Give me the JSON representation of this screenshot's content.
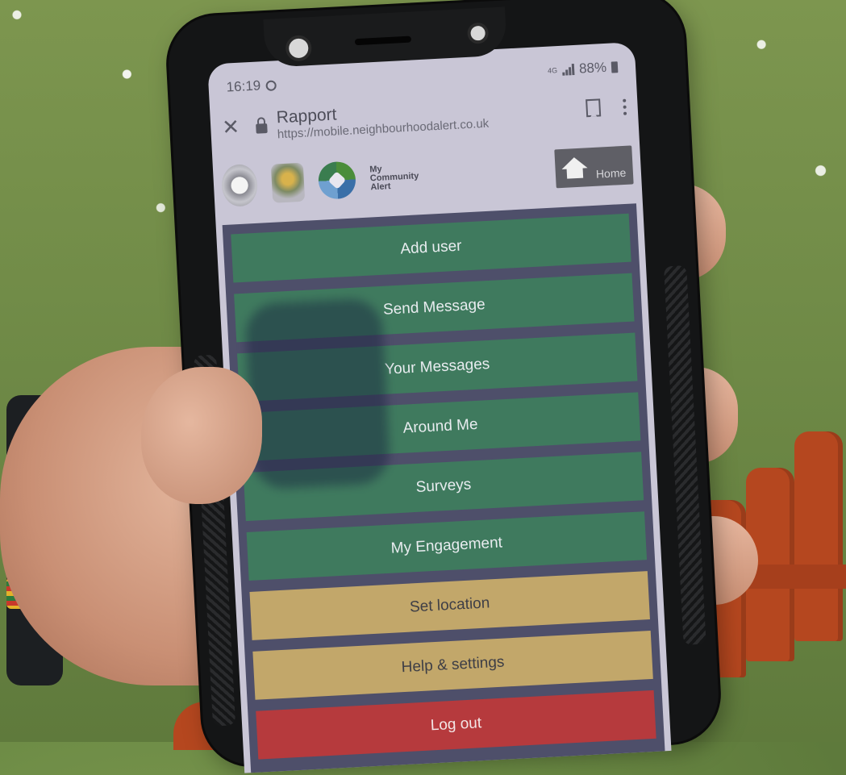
{
  "status_bar": {
    "time": "16:19",
    "time_icon": "circle-icon",
    "network": "4G",
    "signal_icon": "signal-bars-icon",
    "battery": "88%",
    "battery_icon": "battery-icon"
  },
  "browser": {
    "close_icon": "close-icon",
    "lock_icon": "lock-icon",
    "page_title": "Rapport",
    "url": "https://mobile.neighbourhoodalert.co.uk",
    "bookmark_icon": "bookmark-icon",
    "more_icon": "more-vert-icon"
  },
  "header": {
    "logo_text": "My Community Alert",
    "logo_line1": "My",
    "logo_line2": "Community",
    "logo_line3": "Alert",
    "home_label": "Home",
    "home_icon": "home-icon"
  },
  "menu": {
    "items": [
      {
        "label": "Add user",
        "color": "#3f7a5e"
      },
      {
        "label": "Send Message",
        "color": "#3f7a5e"
      },
      {
        "label": "Your Messages",
        "color": "#3f7a5e"
      },
      {
        "label": "Around Me",
        "color": "#3f7a5e"
      },
      {
        "label": "Surveys",
        "color": "#3f7a5e"
      },
      {
        "label": "My Engagement",
        "color": "#3f7a5e"
      },
      {
        "label": "Set location",
        "color": "#c2a76a"
      },
      {
        "label": "Help & settings",
        "color": "#c2a76a"
      },
      {
        "label": "Log out",
        "color": "#b63a3d"
      }
    ]
  }
}
